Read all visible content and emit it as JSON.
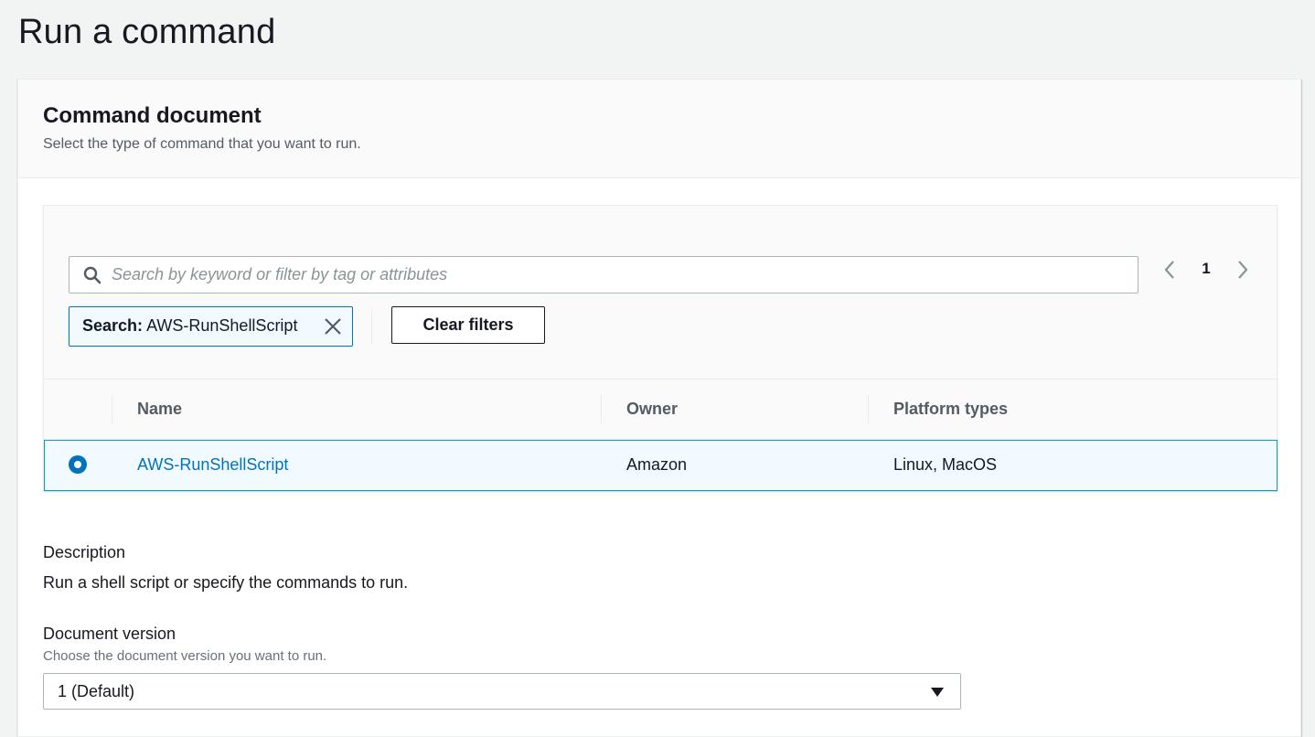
{
  "page": {
    "title": "Run a command"
  },
  "command_document": {
    "title": "Command document",
    "description": "Select the type of command that you want to run."
  },
  "search": {
    "placeholder": "Search by keyword or filter by tag or attributes",
    "value": "",
    "icon": "search-icon"
  },
  "pagination": {
    "current_page": "1"
  },
  "filter_token": {
    "key": "Search:",
    "value": "AWS-RunShellScript"
  },
  "clear_filters_label": "Clear filters",
  "table": {
    "columns": [
      "Name",
      "Owner",
      "Platform types"
    ],
    "rows": [
      {
        "name": "AWS-RunShellScript",
        "owner": "Amazon",
        "platform_types": "Linux, MacOS",
        "selected": true
      }
    ]
  },
  "document_description": {
    "label": "Description",
    "value": "Run a shell script or specify the commands to run."
  },
  "document_version": {
    "label": "Document version",
    "hint": "Choose the document version you want to run.",
    "selected": "1 (Default)"
  },
  "colors": {
    "accent": "#0073bb",
    "selected_row_bg": "#f1faff",
    "selected_row_border": "#00a1c9",
    "page_bg": "#f2f3f3"
  }
}
